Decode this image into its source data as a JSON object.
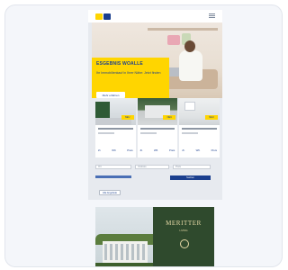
{
  "email": {
    "hero": {
      "title": "ESGEBNIS WOALLE",
      "text": "Ihr Immobilienkauf in Ihrer Nähe: Jetzt finden",
      "button": "Mehr erfahren"
    },
    "cards": [
      {
        "badge": "NEU",
        "specs": [
          "Zi.",
          "Wfl.",
          "Preis"
        ]
      },
      {
        "badge": "NEU",
        "specs": [
          "Zi.",
          "Wfl.",
          "Preis"
        ]
      },
      {
        "badge": "NEU",
        "specs": [
          "Zi.",
          "Wfl.",
          "Preis"
        ]
      }
    ],
    "form": {
      "field1": "Ort",
      "field2": "Umkreis",
      "field3": "Preis",
      "submit": "Suchen"
    },
    "link_button": "Alle Angebote"
  },
  "banner": {
    "heading": "MERITTER",
    "sub": "LIVING"
  },
  "colors": {
    "brand_yellow": "#ffd500",
    "brand_blue": "#1b3f8e",
    "banner_green": "#2f4a2d"
  }
}
